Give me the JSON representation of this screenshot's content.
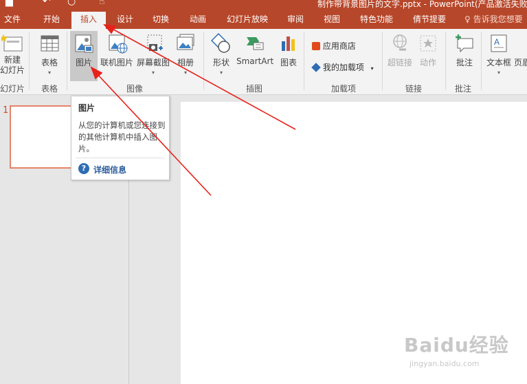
{
  "titlebar": {
    "title": "制作带背景图片的文字.pptx - PowerPoint(产品激活失败)"
  },
  "tabs": [
    "文件",
    "开始",
    "插入",
    "设计",
    "切换",
    "动画",
    "幻灯片放映",
    "审阅",
    "视图",
    "特色功能",
    "倩节提要"
  ],
  "active_tab": "插入",
  "tell_me": "告诉我您想要",
  "ribbon": {
    "new_slide": "新建\n幻灯片",
    "table": "表格",
    "picture": "图片",
    "online_picture": "联机图片",
    "screenshot": "屏幕截图",
    "album": "相册",
    "shapes": "形状",
    "smartart": "SmartArt",
    "chart": "图表",
    "store": "应用商店",
    "my_addins": "我的加载项",
    "hyperlink": "超链接",
    "action": "动作",
    "comment": "批注",
    "textbox": "文本框",
    "header_footer": "页眉",
    "groups": {
      "slides": "幻灯片",
      "tables": "表格",
      "images": "图像",
      "illustrations": "插图",
      "addins": "加载项",
      "links": "链接",
      "comments": "批注"
    }
  },
  "thumbnail": {
    "number": "1"
  },
  "tooltip": {
    "title": "图片",
    "body": "从您的计算机或您连接到的其他计算机中插入图片。",
    "help": "详细信息"
  },
  "watermark": {
    "main": "Baidu经验",
    "url": "jingyan.baidu.com"
  },
  "colors": {
    "accent": "#b7472a",
    "arrow": "#e8221b",
    "thumb_border": "#e8826a"
  },
  "icons": [
    "save-icon",
    "undo-icon",
    "redo-icon",
    "touch-icon",
    "lightbulb-icon",
    "help-icon",
    "dropdown-caret-icon"
  ]
}
